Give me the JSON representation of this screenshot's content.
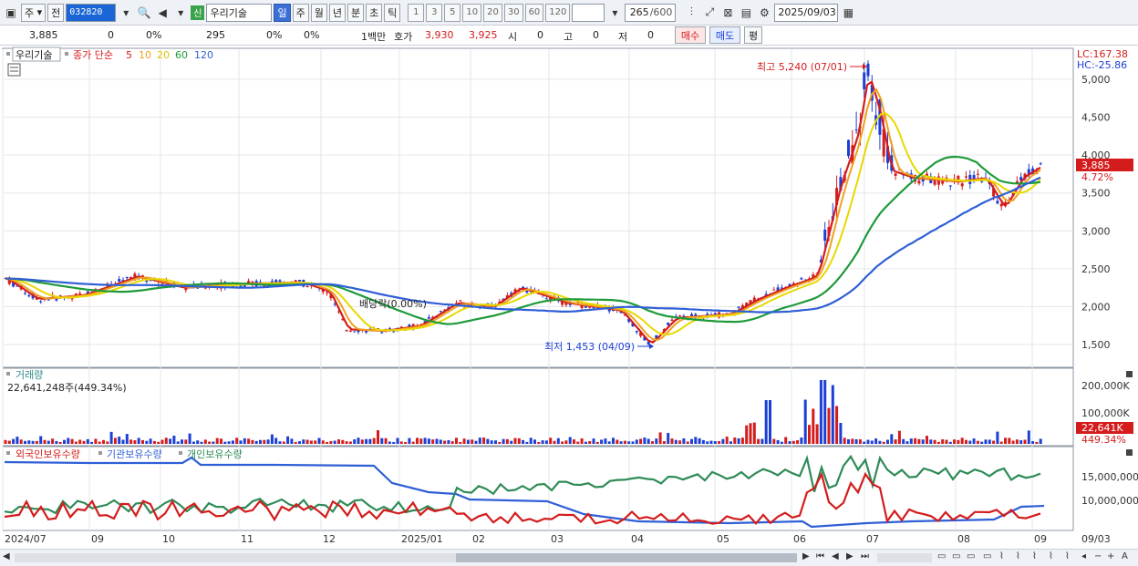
{
  "toolbar": {
    "period_main": "주",
    "prev_label": "전",
    "stock_code": "032820",
    "stock_name": "우리기술",
    "new_badge": "신",
    "periods": [
      "일",
      "주",
      "월",
      "년",
      "분",
      "초",
      "틱"
    ],
    "active_period": "일",
    "intervals": [
      "1",
      "3",
      "5",
      "10",
      "20",
      "30",
      "60",
      "120"
    ],
    "count": "265",
    "count_max": "/600",
    "date": "2025/09/03"
  },
  "info": {
    "price": "3,885",
    "change": "0",
    "change_pct": "0%",
    "volume": "295",
    "vol_pct": "0%",
    "vol_pct2": "0%",
    "unit": "1백만",
    "quote_label": "호가",
    "ask": "3,930",
    "bid": "3,925",
    "open_label": "시",
    "open": "0",
    "high_label": "고",
    "high": "0",
    "low_label": "저",
    "low": "0",
    "buy_label": "매수",
    "sell_label": "매도",
    "avg_label": "평"
  },
  "price_panel": {
    "name": "우리기술",
    "ma_legend": "종가 단순",
    "ma_periods": [
      "5",
      "10",
      "20",
      "60",
      "120"
    ],
    "ma_colors": [
      "#d41c1c",
      "#f0a020",
      "#e8d800",
      "#1e9a3a",
      "#2f5fd6"
    ],
    "lc": "LC:167.38",
    "hc": "HC:-25.86",
    "high_annotation": "최고 5,240 (07/01)",
    "low_annotation": "최저 1,453 (04/09)",
    "dividend_annotation": "배당락(0.00%)",
    "current_price": "3,885",
    "current_pct": "4.72%",
    "y_ticks": [
      "5,000",
      "4,500",
      "4,000",
      "3,500",
      "3,000",
      "2,500",
      "2,000",
      "1,500"
    ]
  },
  "volume_panel": {
    "title": "거래량",
    "value": "22,641,248주(449.34%)",
    "y_ticks": [
      "200,000K",
      "100,000K"
    ],
    "current": "22,641K",
    "current_pct": "449.34%"
  },
  "holding_panel": {
    "legend": [
      "외국인보유수량",
      "기관보유수량",
      "개인보유수량"
    ],
    "colors": [
      "#d41c1c",
      "#2f5fd6",
      "#2e8b57"
    ],
    "y_ticks": [
      "15,000,000",
      "10,000,000"
    ]
  },
  "x_axis": [
    "2024/07",
    "09",
    "10",
    "11",
    "12",
    "2025/01",
    "02",
    "03",
    "04",
    "05",
    "06",
    "07",
    "08",
    "09",
    "09/03"
  ]
}
